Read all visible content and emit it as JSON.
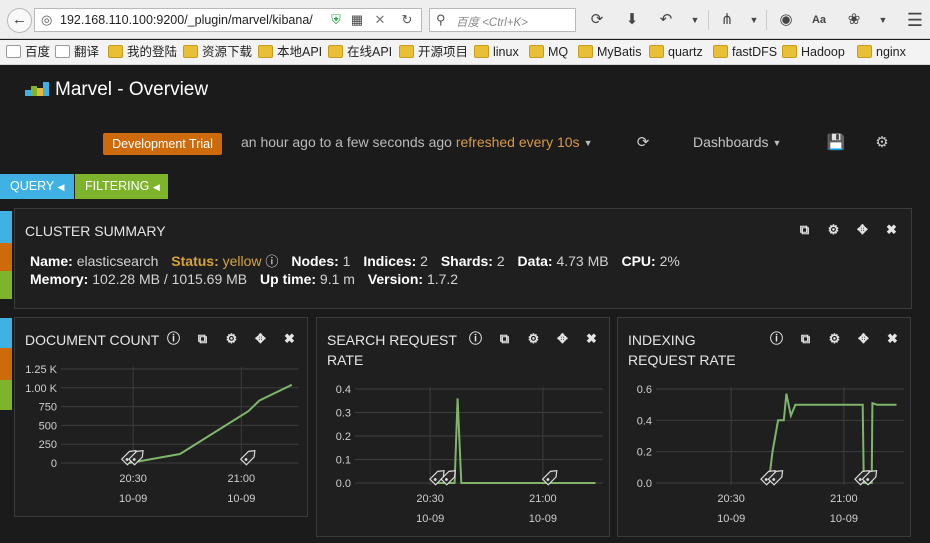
{
  "browser": {
    "address": "192.168.110.100:9200/_plugin/marvel/kibana/",
    "search_placeholder": "百度 <Ctrl+K>"
  },
  "bookmarks": [
    "百度",
    "翻译",
    "我的登陆",
    "资源下载",
    "本地API",
    "在线API",
    "开源项目",
    "linux",
    "MQ",
    "MyBatis",
    "quartz",
    "fastDFS",
    "Hadoop",
    "nginx"
  ],
  "app": {
    "title": "Marvel - Overview",
    "trial_badge": "Development Trial",
    "timespan": "an hour ago to a few seconds ago",
    "refresh": "refreshed every 10s",
    "dashboards_label": "Dashboards"
  },
  "pills": {
    "query": "QUERY",
    "filtering": "FILTERING"
  },
  "colors": {
    "accent_query": "#3fb2e3",
    "accent_filter": "#7eb32c",
    "trial": "#cd6b0c",
    "series": "#7fb56b",
    "status_yellow": "#d7a33f"
  },
  "cluster_summary": {
    "title": "CLUSTER SUMMARY",
    "name_label": "Name:",
    "name": "elasticsearch",
    "status_label": "Status:",
    "status": "yellow",
    "nodes_label": "Nodes:",
    "nodes": "1",
    "indices_label": "Indices:",
    "indices": "2",
    "shards_label": "Shards:",
    "shards": "2",
    "data_label": "Data:",
    "data": "4.73 MB",
    "cpu_label": "CPU:",
    "cpu": "2%",
    "memory_label": "Memory:",
    "memory": "102.28 MB / 1015.69 MB",
    "uptime_label": "Up time:",
    "uptime": "9.1 m",
    "version_label": "Version:",
    "version": "1.7.2"
  },
  "panels": {
    "document_count": {
      "title": "DOCUMENT COUNT"
    },
    "search_rate": {
      "title_line1": "SEARCH REQUEST",
      "title_line2": "RATE"
    },
    "indexing_rate": {
      "title_line1": "INDEXING",
      "title_line2": "REQUEST RATE"
    }
  },
  "chart_data": [
    {
      "type": "line",
      "yticks": [
        "1.25 K",
        "1.00 K",
        "750",
        "500",
        "250",
        "0"
      ],
      "ylim": [
        0,
        1250
      ],
      "xticks": [
        {
          "time": "20:30",
          "date": "10-09",
          "t": 30
        },
        {
          "time": "21:00",
          "date": "10-09",
          "t": 60
        }
      ],
      "xlim": [
        10,
        76
      ],
      "series": [
        {
          "points": [
            [
              29,
              0
            ],
            [
              43,
              120
            ],
            [
              62,
              690
            ],
            [
              65,
              830
            ],
            [
              74,
              1040
            ]
          ]
        }
      ],
      "markers": [
        29,
        31,
        62
      ]
    },
    {
      "type": "line",
      "yticks": [
        "0.4",
        "0.3",
        "0.2",
        "0.1",
        "0.0"
      ],
      "ylim": [
        0,
        0.4
      ],
      "xticks": [
        {
          "time": "20:30",
          "date": "10-09",
          "t": 30
        },
        {
          "time": "21:00",
          "date": "10-09",
          "t": 60
        }
      ],
      "xlim": [
        10,
        76
      ],
      "series": [
        {
          "points": [
            [
              32,
              0
            ],
            [
              36.5,
              0
            ],
            [
              37.3,
              0.36
            ],
            [
              38.3,
              0
            ],
            [
              74,
              0
            ]
          ]
        }
      ],
      "markers": [
        32,
        35,
        62
      ]
    },
    {
      "type": "line",
      "yticks": [
        "0.6",
        "0.4",
        "0.2",
        "0.0"
      ],
      "ylim": [
        0,
        0.6
      ],
      "xticks": [
        {
          "time": "20:30",
          "date": "10-09",
          "t": 30
        },
        {
          "time": "21:00",
          "date": "10-09",
          "t": 60
        }
      ],
      "xlim": [
        10,
        76
      ],
      "series": [
        {
          "points": [
            [
              40,
              0
            ],
            [
              41,
              0.2
            ],
            [
              42.5,
              0.4
            ],
            [
              44,
              0.4
            ],
            [
              44.7,
              0.57
            ],
            [
              45.3,
              0.5
            ],
            [
              45.9,
              0.43
            ],
            [
              47.1,
              0.5
            ],
            [
              65,
              0.5
            ],
            [
              65.3,
              0
            ],
            [
              67.4,
              0
            ],
            [
              67.6,
              0.51
            ],
            [
              68.8,
              0.5
            ],
            [
              74,
              0.5
            ]
          ]
        }
      ],
      "markers": [
        40,
        42,
        65,
        67
      ]
    }
  ]
}
